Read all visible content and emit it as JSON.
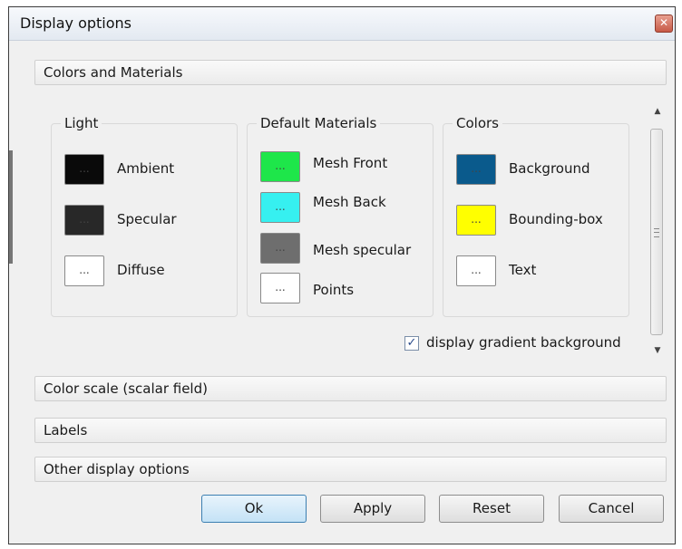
{
  "window": {
    "title": "Display options",
    "close_glyph": "✕"
  },
  "sections": {
    "colors_materials": "Colors and Materials",
    "color_scale": "Color scale (scalar field)",
    "labels": "Labels",
    "other": "Other display options"
  },
  "light": {
    "title": "Light",
    "items": [
      {
        "label": "Ambient",
        "color": "#0a0a0a",
        "button": "..."
      },
      {
        "label": "Specular",
        "color": "#282828",
        "button": "..."
      },
      {
        "label": "Diffuse",
        "color": "#ffffff",
        "button": "..."
      }
    ]
  },
  "materials": {
    "title": "Default Materials",
    "items": [
      {
        "label": "Mesh Front",
        "color": "#1ee64a",
        "button": "..."
      },
      {
        "label": "Mesh Back",
        "color": "#36f0f0",
        "button": "..."
      },
      {
        "label": "Mesh specular",
        "color": "#6e6e6e",
        "button": "..."
      },
      {
        "label": "Points",
        "color": "#ffffff",
        "button": "..."
      }
    ]
  },
  "colors": {
    "title": "Colors",
    "items": [
      {
        "label": "Background",
        "color": "#0a5a8c",
        "button": "..."
      },
      {
        "label": "Bounding-box",
        "color": "#ffff00",
        "button": "..."
      },
      {
        "label": "Text",
        "color": "#ffffff",
        "button": "..."
      }
    ]
  },
  "gradient": {
    "label": "display gradient background",
    "checked": true,
    "check_glyph": "✓"
  },
  "scrollbar": {
    "up_glyph": "▲",
    "down_glyph": "▼"
  },
  "buttons": {
    "ok": "Ok",
    "apply": "Apply",
    "reset": "Reset",
    "cancel": "Cancel"
  }
}
